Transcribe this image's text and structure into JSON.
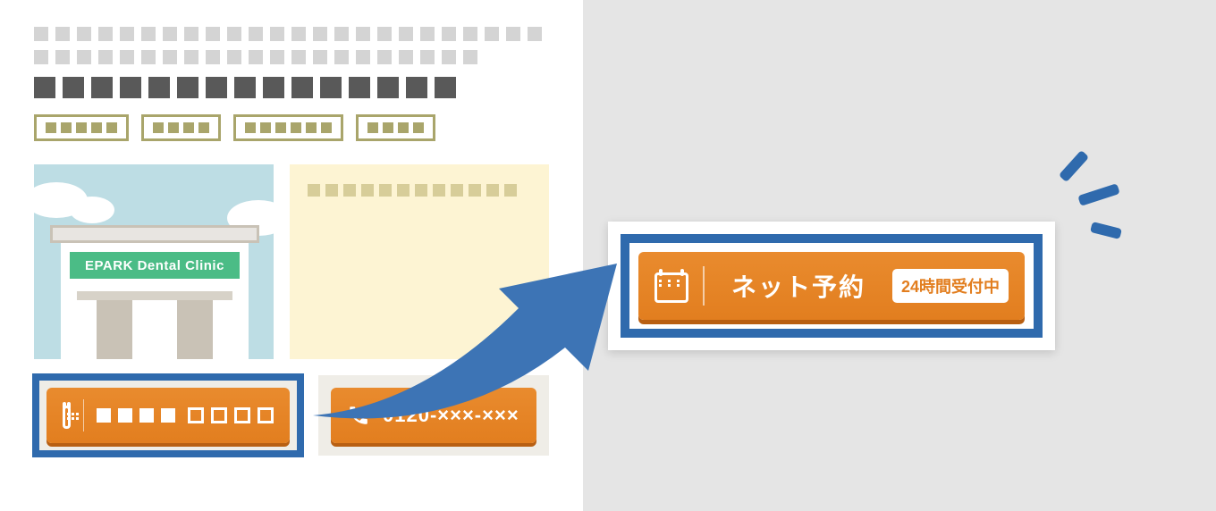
{
  "clinic_sign": "EPARK Dental Clinic",
  "phone_number": "0120-×××-×××",
  "big_button": {
    "label": "ネット予約",
    "badge": "24時間受付中"
  },
  "placeholder_counts": {
    "row1": 24,
    "row2": 21,
    "dark_row": 15,
    "tags": [
      5,
      4,
      6,
      4
    ],
    "yellow_row": 12,
    "small_btn_solid": 4,
    "small_btn_outline": 4
  }
}
